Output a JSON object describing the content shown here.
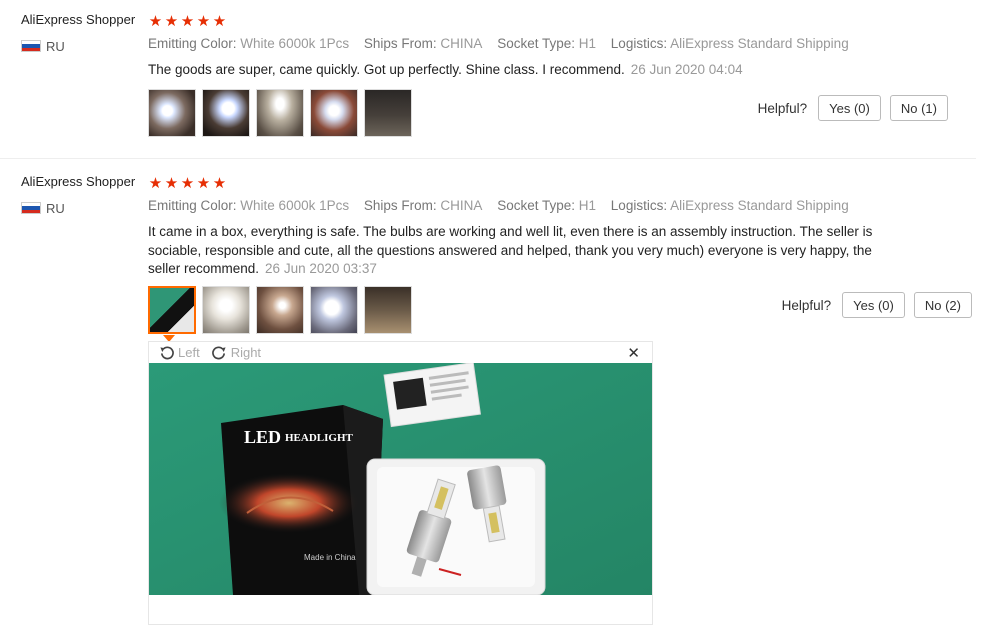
{
  "reviews": [
    {
      "user": "AliExpress Shopper",
      "rating": 5,
      "country": "RU",
      "attributes": [
        {
          "key": "Emitting Color:",
          "value": "White 6000k 1Pcs"
        },
        {
          "key": "Ships From:",
          "value": "CHINA"
        },
        {
          "key": "Socket Type:",
          "value": "H1"
        },
        {
          "key": "Logistics:",
          "value": "AliExpress Standard Shipping"
        }
      ],
      "text": "The goods are super, came quickly. Got up perfectly. Shine class. I recommend.",
      "date": "26 Jun 2020 04:04",
      "helpful_label": "Helpful?",
      "yes_label": "Yes (0)",
      "no_label": "No (1)"
    },
    {
      "user": "AliExpress Shopper",
      "rating": 5,
      "country": "RU",
      "attributes": [
        {
          "key": "Emitting Color:",
          "value": "White 6000k 1Pcs"
        },
        {
          "key": "Ships From:",
          "value": "CHINA"
        },
        {
          "key": "Socket Type:",
          "value": "H1"
        },
        {
          "key": "Logistics:",
          "value": "AliExpress Standard Shipping"
        }
      ],
      "text": "It came in a box, everything is safe. The bulbs are working and well lit, even there is an assembly instruction. The seller is sociable, responsible and cute, all the questions answered and helped, thank you very much) everyone is very happy, the seller recommend.",
      "date": "26 Jun 2020 03:37",
      "helpful_label": "Helpful?",
      "yes_label": "Yes (0)",
      "no_label": "No (2)"
    }
  ],
  "viewer": {
    "rotate_left": "Left",
    "rotate_right": "Right",
    "close_symbol": "✕",
    "box_title_led": "LED",
    "box_title_headlight": "HEADLIGHT",
    "box_made_in": "Made in China"
  },
  "star_char": "★",
  "colors": {
    "star": "#e62e04",
    "accent": "#ff6a00",
    "photo_background": "#2f9676"
  }
}
